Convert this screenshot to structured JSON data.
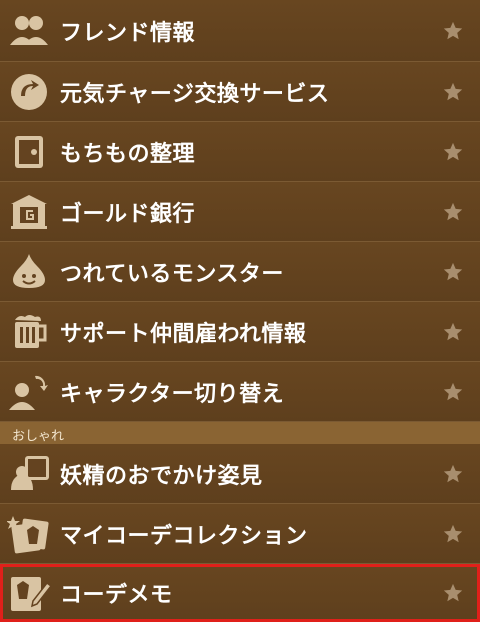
{
  "menu": {
    "items": [
      {
        "label": "フレンド情報",
        "icon": "friends-icon"
      },
      {
        "label": "元気チャージ交換サービス",
        "icon": "energy-exchange-icon"
      },
      {
        "label": "もちもの整理",
        "icon": "safe-icon"
      },
      {
        "label": "ゴールド銀行",
        "icon": "bank-icon"
      },
      {
        "label": "つれているモンスター",
        "icon": "slime-icon"
      },
      {
        "label": "サポート仲間雇われ情報",
        "icon": "beer-mug-icon"
      },
      {
        "label": "キャラクター切り替え",
        "icon": "character-switch-icon"
      }
    ],
    "section_label": "おしゃれ",
    "fashion_items": [
      {
        "label": "妖精のおでかけ姿見",
        "icon": "fairy-mirror-icon"
      },
      {
        "label": "マイコーデコレクション",
        "icon": "outfit-collection-icon"
      },
      {
        "label": "コーデメモ",
        "icon": "outfit-memo-icon",
        "highlighted": true
      }
    ]
  },
  "colors": {
    "row_bg": "#644320",
    "divider": "#7b5a33",
    "section_bg": "#8a6433",
    "icon": "#d9c4a3",
    "star": "#a88e6e",
    "highlight": "#e0201a"
  }
}
